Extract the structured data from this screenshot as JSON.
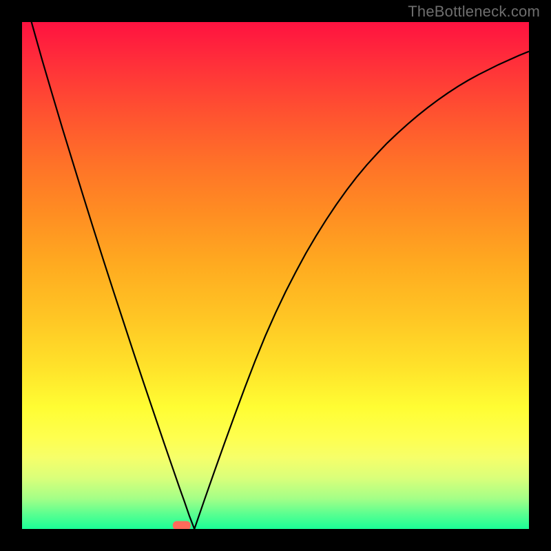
{
  "watermark": "TheBottleneck.com",
  "chart_data": {
    "type": "line",
    "title": "",
    "xlabel": "",
    "ylabel": "",
    "xlim": [
      0,
      100
    ],
    "ylim": [
      0,
      100
    ],
    "grid": false,
    "legend": false,
    "x": [
      0,
      2,
      4,
      6,
      8,
      10,
      12,
      14,
      16,
      18,
      20,
      22,
      24,
      26,
      28,
      30,
      31,
      31.5,
      32,
      33,
      34,
      36,
      38,
      40,
      42,
      44,
      46,
      48,
      50,
      52,
      54,
      56,
      58,
      60,
      62,
      64,
      66,
      68,
      70,
      72,
      74,
      76,
      78,
      80,
      82,
      84,
      86,
      88,
      90,
      92,
      94,
      96,
      98,
      100
    ],
    "y": [
      107,
      99.5,
      92.4,
      85.6,
      78.9,
      72.4,
      65.9,
      59.5,
      53.2,
      47,
      40.9,
      34.8,
      28.8,
      22.9,
      17,
      11.2,
      8.3,
      6.9,
      5.5,
      2.6,
      0,
      5.8,
      11.5,
      17.1,
      22.6,
      28,
      33.2,
      38.1,
      42.6,
      46.8,
      50.7,
      54.4,
      57.8,
      61,
      64,
      66.8,
      69.4,
      71.8,
      74,
      76.1,
      78,
      79.8,
      81.5,
      83.1,
      84.6,
      86,
      87.3,
      88.5,
      89.6,
      90.6,
      91.6,
      92.5,
      93.4,
      94.2
    ],
    "marker": {
      "x": 31.5,
      "y_baseline_offset": 0
    },
    "colors": {
      "curve": "#000000",
      "marker": "#ff6a5a"
    }
  }
}
